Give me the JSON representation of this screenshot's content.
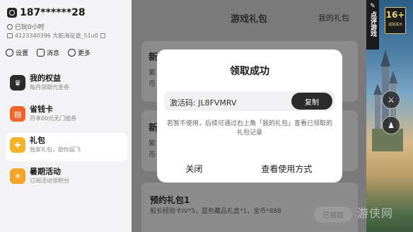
{
  "user": {
    "name": "187******28",
    "playtime": "已玩0小时",
    "uid_line": "4123340396  大航海征途_51u0"
  },
  "quick_actions": [
    {
      "label": "设置",
      "icon": "gear-icon"
    },
    {
      "label": "消息",
      "icon": "message-icon"
    },
    {
      "label": "更多",
      "icon": "more-icon"
    }
  ],
  "menu": [
    {
      "title": "我的权益",
      "sub": "每月领取代金券",
      "icon": "crown-icon",
      "color": "#2b2b2b",
      "active": false
    },
    {
      "title": "省钱卡",
      "sub": "月享60元无门槛券",
      "icon": "card-icon",
      "color": "#f0642a",
      "active": false
    },
    {
      "title": "礼包",
      "sub": "独家礼包，助你超飞",
      "icon": "gift-icon",
      "color": "#f5b32c",
      "active": true
    },
    {
      "title": "暑期活动",
      "sub": "订阅活动领积分",
      "icon": "summer-icon",
      "color": "#f4a42a",
      "active": false
    }
  ],
  "main": {
    "title": "游戏礼包",
    "my_gifts": "我的礼包",
    "card1_title": "新",
    "card1_l1": "紫",
    "card1_l2": "币",
    "card2_title": "新",
    "card2_l1": "紫",
    "card2_l2": "币",
    "preorder_title": "预约礼包1",
    "preorder_desc": "船长经验卡IV*5，蓝色藏品礼盒*1，金币*888",
    "preorder_btn": "已领取"
  },
  "side": {
    "review_label": "点评游戏",
    "age_rating": "16+",
    "age_sub": "适龄提示"
  },
  "modal": {
    "title": "领取成功",
    "code_label": "激活码: JL8FVMRV",
    "copy_label": "复制",
    "note": "若暂不使用，后续可通过右上角「我的礼包」查看已领取的礼包记录",
    "close_label": "关闭",
    "view_label": "查看使用方式"
  },
  "watermark": "游侠网"
}
